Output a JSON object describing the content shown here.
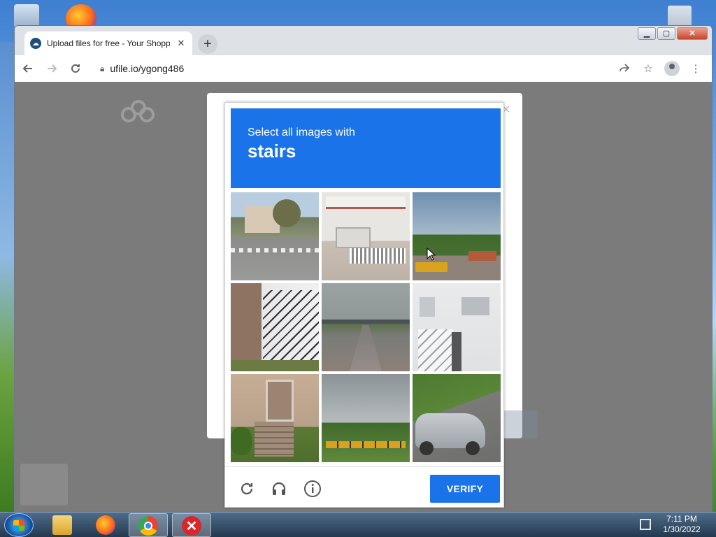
{
  "desktop": {
    "icons": [
      "recycle-bin-icon",
      "firefox-icon",
      "recycle-bin-full-icon"
    ]
  },
  "browser": {
    "window_controls": {
      "minimize": "▁",
      "maximize": "▢",
      "close": "✕"
    },
    "tab": {
      "title": "Upload files for free - Your Shopp",
      "close": "✕"
    },
    "newtab": "+",
    "url": "ufile.io/ygong486"
  },
  "captcha": {
    "prompt": "Select all images with",
    "keyword": "stairs",
    "tiles": [
      "street-intersection",
      "rv-camper",
      "school-bus-lot",
      "house-exterior-stairs",
      "highway-overpass",
      "white-house-stairs",
      "porch-stairs",
      "bus-parking-lot",
      "parked-car"
    ],
    "footer_icons": [
      "reload-icon",
      "audio-challenge-icon",
      "info-icon"
    ],
    "verify_label": "VERIFY",
    "accent": "#1a73e8"
  },
  "taskbar": {
    "apps": [
      "file-explorer-icon",
      "firefox-icon",
      "chrome-icon",
      "error-app-icon"
    ],
    "time": "7:11 PM",
    "date": "1/30/2022"
  }
}
